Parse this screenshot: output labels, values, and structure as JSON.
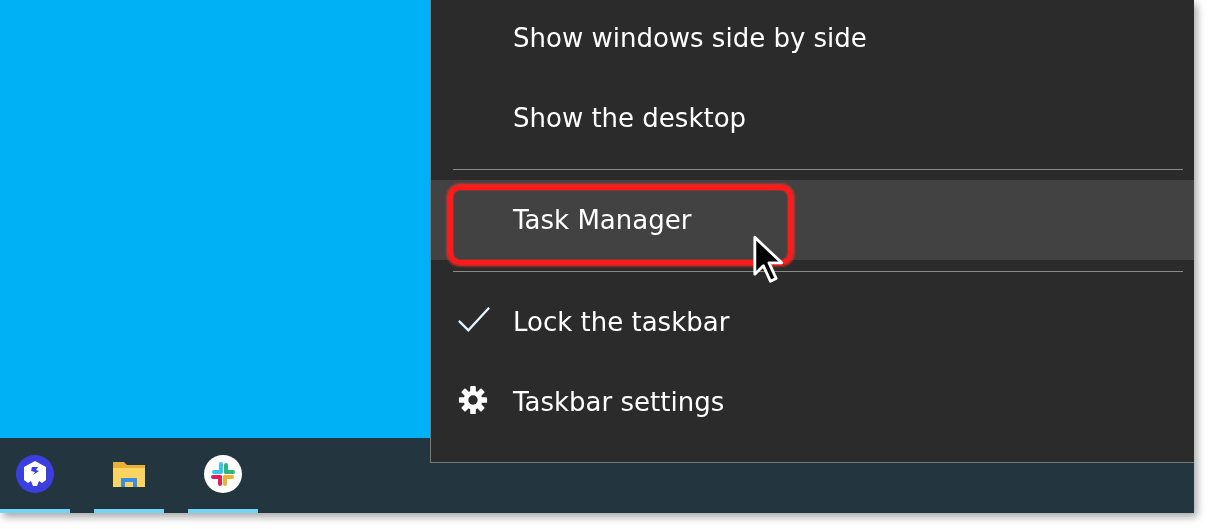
{
  "context_menu": {
    "items": [
      {
        "kind": "plain",
        "label": "Show windows side by side",
        "hovered": false
      },
      {
        "kind": "plain",
        "label": "Show the desktop",
        "hovered": false
      },
      {
        "kind": "separator"
      },
      {
        "kind": "plain",
        "label": "Task Manager",
        "hovered": true,
        "highlighted": true
      },
      {
        "kind": "separator"
      },
      {
        "kind": "plain",
        "label": "Lock the taskbar",
        "hovered": false,
        "checked": true
      },
      {
        "kind": "gear",
        "label": "Taskbar settings",
        "hovered": false
      }
    ]
  },
  "taskbar": {
    "apps": [
      {
        "kind": "cube",
        "running": true
      },
      {
        "kind": "folder",
        "running": true
      },
      {
        "kind": "hash",
        "running": true
      }
    ]
  }
}
